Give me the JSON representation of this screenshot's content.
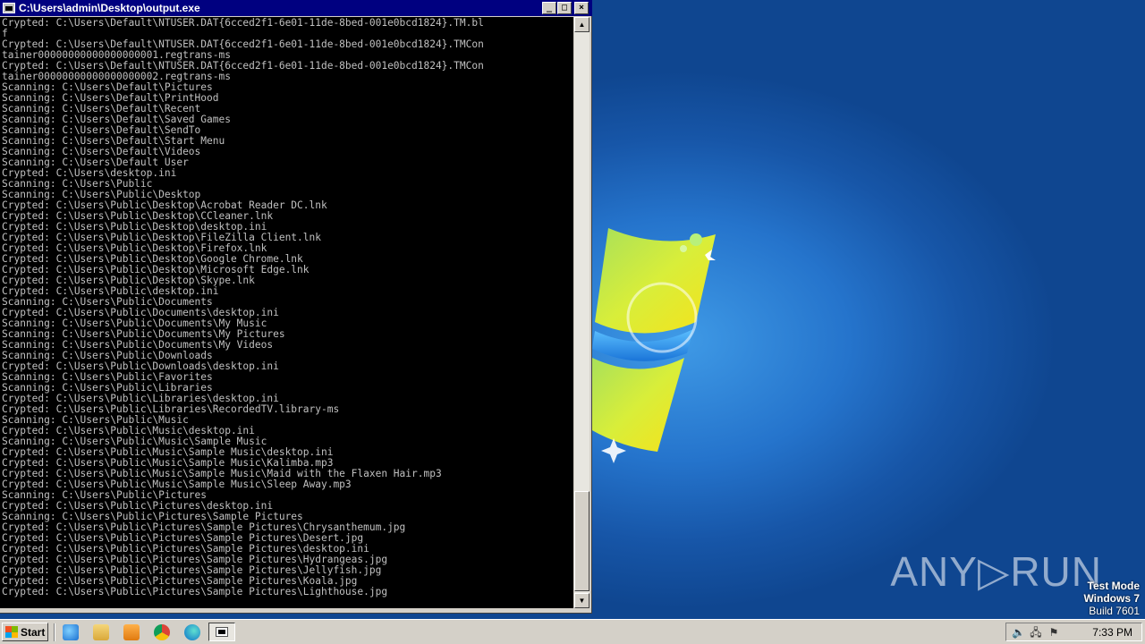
{
  "window": {
    "title": "C:\\Users\\admin\\Desktop\\output.exe",
    "controls": {
      "minimize": "_",
      "maximize": "□",
      "close": "×"
    }
  },
  "console_lines": [
    "Crypted: C:\\Users\\Default\\NTUSER.DAT{6cced2f1-6e01-11de-8bed-001e0bcd1824}.TM.bl",
    "f",
    "Crypted: C:\\Users\\Default\\NTUSER.DAT{6cced2f1-6e01-11de-8bed-001e0bcd1824}.TMCon",
    "tainer00000000000000000001.regtrans-ms",
    "Crypted: C:\\Users\\Default\\NTUSER.DAT{6cced2f1-6e01-11de-8bed-001e0bcd1824}.TMCon",
    "tainer00000000000000000002.regtrans-ms",
    "Scanning: C:\\Users\\Default\\Pictures",
    "Scanning: C:\\Users\\Default\\PrintHood",
    "Scanning: C:\\Users\\Default\\Recent",
    "Scanning: C:\\Users\\Default\\Saved Games",
    "Scanning: C:\\Users\\Default\\SendTo",
    "Scanning: C:\\Users\\Default\\Start Menu",
    "Scanning: C:\\Users\\Default\\Videos",
    "Scanning: C:\\Users\\Default User",
    "Crypted: C:\\Users\\desktop.ini",
    "Scanning: C:\\Users\\Public",
    "Scanning: C:\\Users\\Public\\Desktop",
    "Crypted: C:\\Users\\Public\\Desktop\\Acrobat Reader DC.lnk",
    "Crypted: C:\\Users\\Public\\Desktop\\CCleaner.lnk",
    "Crypted: C:\\Users\\Public\\Desktop\\desktop.ini",
    "Crypted: C:\\Users\\Public\\Desktop\\FileZilla Client.lnk",
    "Crypted: C:\\Users\\Public\\Desktop\\Firefox.lnk",
    "Crypted: C:\\Users\\Public\\Desktop\\Google Chrome.lnk",
    "Crypted: C:\\Users\\Public\\Desktop\\Microsoft Edge.lnk",
    "Crypted: C:\\Users\\Public\\Desktop\\Skype.lnk",
    "Crypted: C:\\Users\\Public\\desktop.ini",
    "Scanning: C:\\Users\\Public\\Documents",
    "Crypted: C:\\Users\\Public\\Documents\\desktop.ini",
    "Scanning: C:\\Users\\Public\\Documents\\My Music",
    "Scanning: C:\\Users\\Public\\Documents\\My Pictures",
    "Scanning: C:\\Users\\Public\\Documents\\My Videos",
    "Scanning: C:\\Users\\Public\\Downloads",
    "Crypted: C:\\Users\\Public\\Downloads\\desktop.ini",
    "Scanning: C:\\Users\\Public\\Favorites",
    "Scanning: C:\\Users\\Public\\Libraries",
    "Crypted: C:\\Users\\Public\\Libraries\\desktop.ini",
    "Crypted: C:\\Users\\Public\\Libraries\\RecordedTV.library-ms",
    "Scanning: C:\\Users\\Public\\Music",
    "Crypted: C:\\Users\\Public\\Music\\desktop.ini",
    "Scanning: C:\\Users\\Public\\Music\\Sample Music",
    "Crypted: C:\\Users\\Public\\Music\\Sample Music\\desktop.ini",
    "Crypted: C:\\Users\\Public\\Music\\Sample Music\\Kalimba.mp3",
    "Crypted: C:\\Users\\Public\\Music\\Sample Music\\Maid with the Flaxen Hair.mp3",
    "Crypted: C:\\Users\\Public\\Music\\Sample Music\\Sleep Away.mp3",
    "Scanning: C:\\Users\\Public\\Pictures",
    "Crypted: C:\\Users\\Public\\Pictures\\desktop.ini",
    "Scanning: C:\\Users\\Public\\Pictures\\Sample Pictures",
    "Crypted: C:\\Users\\Public\\Pictures\\Sample Pictures\\Chrysanthemum.jpg",
    "Crypted: C:\\Users\\Public\\Pictures\\Sample Pictures\\Desert.jpg",
    "Crypted: C:\\Users\\Public\\Pictures\\Sample Pictures\\desktop.ini",
    "Crypted: C:\\Users\\Public\\Pictures\\Sample Pictures\\Hydrangeas.jpg",
    "Crypted: C:\\Users\\Public\\Pictures\\Sample Pictures\\Jellyfish.jpg",
    "Crypted: C:\\Users\\Public\\Pictures\\Sample Pictures\\Koala.jpg",
    "Crypted: C:\\Users\\Public\\Pictures\\Sample Pictures\\Lighthouse.jpg"
  ],
  "desktop": {
    "watermark": "ANY▷RUN",
    "test_mode": {
      "line1": "Test Mode",
      "line2": "Windows 7",
      "line3": "Build 7601"
    }
  },
  "taskbar": {
    "start_label": "Start",
    "quick_launch": [
      "ie-icon",
      "explorer-icon",
      "media-player-icon",
      "chrome-icon",
      "edge-icon"
    ],
    "active_task": "console-window-icon",
    "tray_icons": [
      "volume-icon",
      "network-icon",
      "flag-icon"
    ],
    "clock": "7:33 PM"
  },
  "colors": {
    "titlebar": "#000080",
    "console_bg": "#000000",
    "console_text": "#c0c0c0",
    "desktop": "#1d63b8",
    "taskbar": "#d4d0c8"
  }
}
